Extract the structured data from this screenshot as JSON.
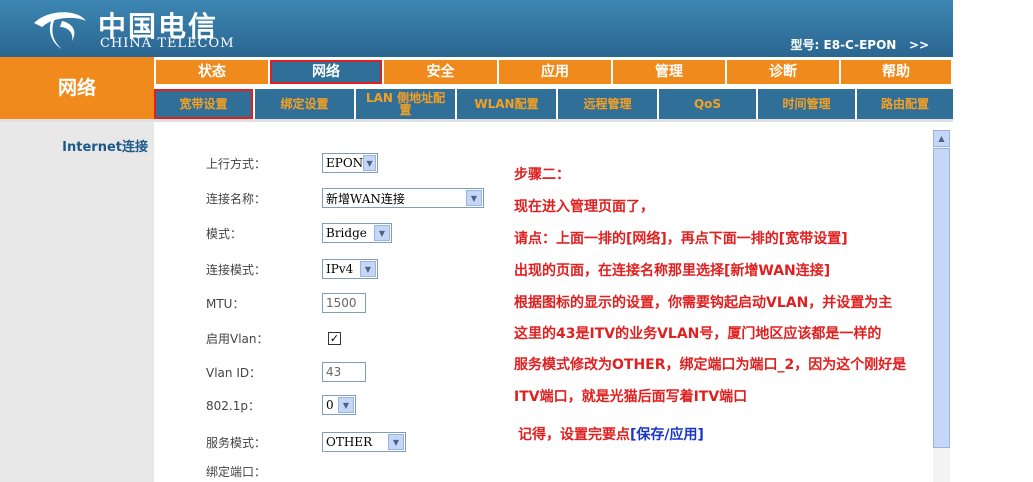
{
  "header": {
    "logo_cn": "中国电信",
    "logo_en": "CHINA TELECOM",
    "model": "型号: E8-C-EPON   >>"
  },
  "section_title": "网络",
  "top_tabs": [
    "状态",
    "网络",
    "安全",
    "应用",
    "管理",
    "诊断",
    "帮助"
  ],
  "sub_tabs": [
    "宽带设置",
    "绑定设置",
    "LAN 侧地址配置",
    "WLAN配置",
    "远程管理",
    "QoS",
    "时间管理",
    "路由配置"
  ],
  "left_nav": {
    "item": "Internet连接"
  },
  "form": {
    "uplink": {
      "label": "上行方式：",
      "value": "EPON"
    },
    "conn_name": {
      "label": "连接名称：",
      "value": "新增WAN连接"
    },
    "mode": {
      "label": "模式：",
      "value": "Bridge"
    },
    "conn_mode": {
      "label": "连接模式：",
      "value": "IPv4"
    },
    "mtu": {
      "label": "MTU：",
      "value": "1500"
    },
    "vlan_enable": {
      "label": "启用Vlan：",
      "checked": "✓"
    },
    "vlan_id": {
      "label": "Vlan ID：",
      "value": "43"
    },
    "p8021": {
      "label": "802.1p：",
      "value": "0"
    },
    "service_mode": {
      "label": "服务模式：",
      "value": "OTHER"
    },
    "bind_port": {
      "label": "绑定端口："
    }
  },
  "annotation": {
    "line1": "步骤二：",
    "line2": "现在进入管理页面了，",
    "line3": "请点：上面一排的[网络]，再点下面一排的[宽带设置]",
    "line4": "出现的页面，在连接名称那里选择[新增WAN连接]",
    "line5": "根据图标的显示的设置，你需要钩起启动VLAN，并设置为主",
    "line6": "这里的43是ITV的业务VLAN号，厦门地区应该都是一样的",
    "line7": "服务模式修改为OTHER，绑定端口为端口_2，因为这个刚好是",
    "line8": "ITV端口，就是光猫后面写着ITV端口",
    "line9_prefix": "记得，设置完要点",
    "line9_highlight": "[保存/应用]"
  },
  "colors": {
    "orange": "#f08a1c",
    "blue": "#2f6f98",
    "red_annotation": "#e02020",
    "highlight_blue": "#1a36c8"
  }
}
